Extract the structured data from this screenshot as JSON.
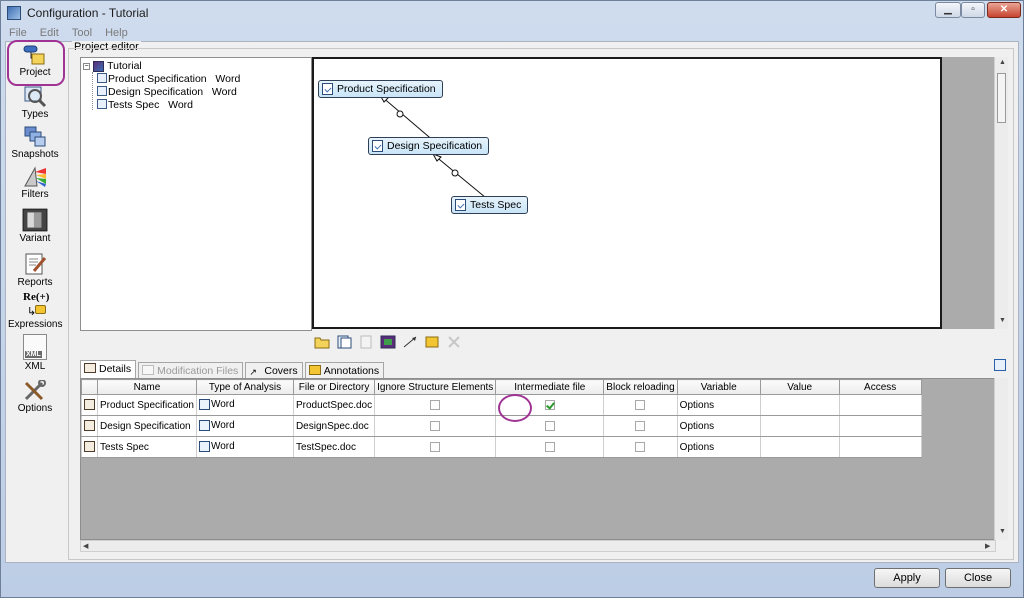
{
  "window": {
    "title": "Configuration - Tutorial",
    "min": "▁",
    "max": "▫",
    "close": "✕"
  },
  "menu": [
    "File",
    "Edit",
    "Tool",
    "Help"
  ],
  "sidebar": [
    {
      "label": "Project",
      "icon": "project-icon"
    },
    {
      "label": "Types",
      "icon": "types-icon"
    },
    {
      "label": "Snapshots",
      "icon": "snapshots-icon"
    },
    {
      "label": "Filters",
      "icon": "filters-icon"
    },
    {
      "label": "Variant",
      "icon": "variant-icon"
    },
    {
      "label": "Reports",
      "icon": "reports-icon"
    },
    {
      "label": "Expressions",
      "icon": "expressions-icon",
      "icon_text": "Re(+)"
    },
    {
      "label": "XML",
      "icon": "xml-icon",
      "icon_text": "XML"
    },
    {
      "label": "Options",
      "icon": "options-icon"
    }
  ],
  "group_label": "Project editor",
  "tree": {
    "root": "Tutorial",
    "children": [
      {
        "name": "Product Specification",
        "type": "Word"
      },
      {
        "name": "Design Specification",
        "type": "Word"
      },
      {
        "name": "Tests Spec",
        "type": "Word"
      }
    ]
  },
  "graph": {
    "nodes": [
      "Product Specification",
      "Design Specification",
      "Tests Spec"
    ]
  },
  "tabs": [
    {
      "label": "Details",
      "state": "active"
    },
    {
      "label": "Modification Files",
      "state": "disabled"
    },
    {
      "label": "Covers",
      "state": "normal"
    },
    {
      "label": "Annotations",
      "state": "normal"
    }
  ],
  "table": {
    "columns": [
      "",
      "Name",
      "Type of Analysis",
      "File or Directory",
      "Ignore Structure Elements",
      "Intermediate file",
      "Block reloading",
      "Variable",
      "Value",
      "Access"
    ],
    "rows": [
      {
        "name": "Product Specification",
        "type": "Word",
        "file": "ProductSpec.doc",
        "ignore": false,
        "intermediate": true,
        "block": false,
        "variable": "Options",
        "value": "",
        "access": ""
      },
      {
        "name": "Design Specification",
        "type": "Word",
        "file": "DesignSpec.doc",
        "ignore": false,
        "intermediate": false,
        "block": false,
        "variable": "Options",
        "value": "",
        "access": ""
      },
      {
        "name": "Tests Spec",
        "type": "Word",
        "file": "TestSpec.doc",
        "ignore": false,
        "intermediate": false,
        "block": false,
        "variable": "Options",
        "value": "",
        "access": ""
      }
    ]
  },
  "buttons": {
    "apply": "Apply",
    "close": "Close"
  },
  "colors": {
    "highlight_ring": "#a03494",
    "node_fill": "#c9e5f7",
    "empty_area": "#ababab"
  }
}
